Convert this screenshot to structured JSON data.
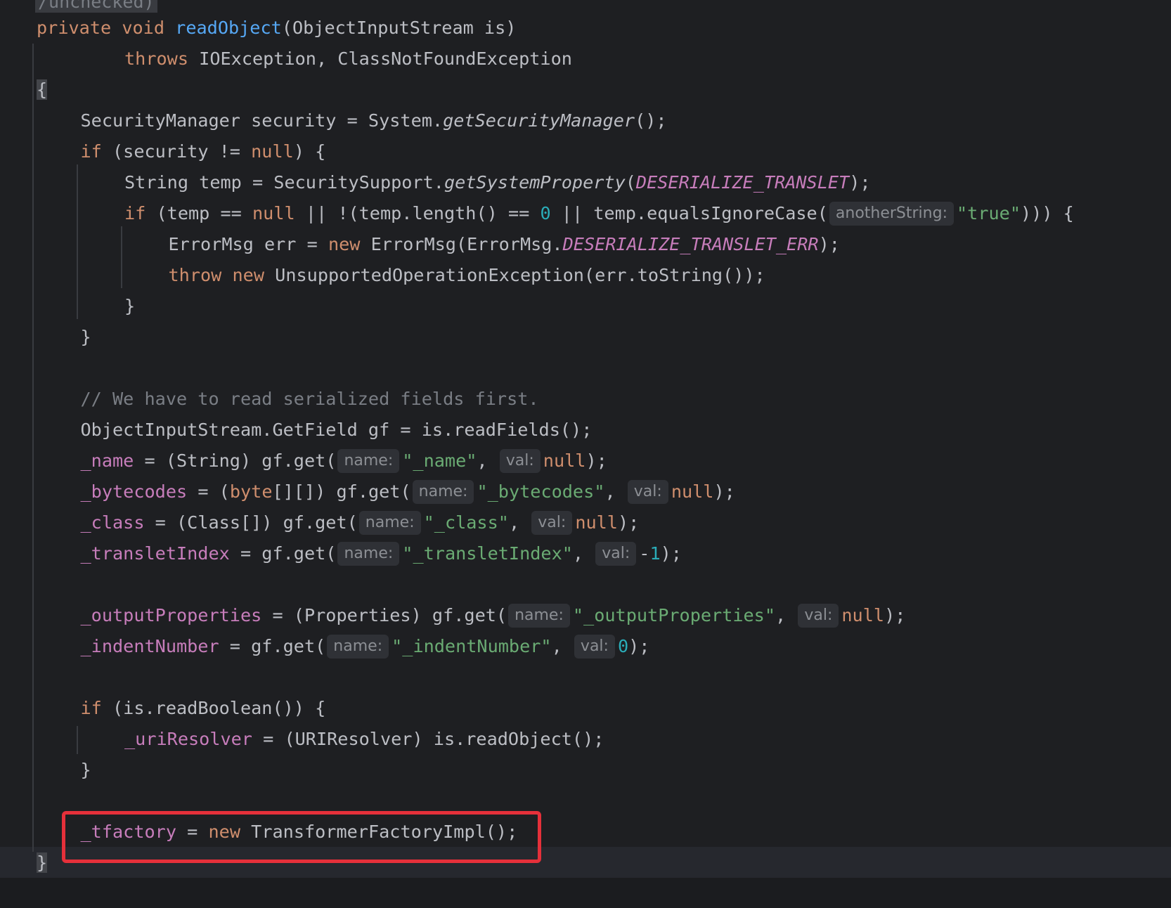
{
  "editor": {
    "partial_top_line": "/unchecked)",
    "lines": [
      {
        "indent": 0,
        "tokens": [
          [
            "kw",
            "private "
          ],
          [
            "kw",
            "void "
          ],
          [
            "fn",
            "readObject"
          ],
          [
            "plain",
            "(ObjectInputStream is)"
          ]
        ]
      },
      {
        "indent": 2,
        "tokens": [
          [
            "kw",
            "throws "
          ],
          [
            "plain",
            "IOException, ClassNotFoundException"
          ]
        ]
      },
      {
        "indent": 0,
        "tokens": [
          [
            "brace",
            "{"
          ]
        ]
      },
      {
        "indent": 1,
        "tokens": [
          [
            "plain",
            "SecurityManager security = System."
          ],
          [
            "static",
            "getSecurityManager"
          ],
          [
            "plain",
            "();"
          ]
        ]
      },
      {
        "indent": 1,
        "tokens": [
          [
            "kw",
            "if "
          ],
          [
            "plain",
            "(security != "
          ],
          [
            "kw",
            "null"
          ],
          [
            "plain",
            ") {"
          ]
        ]
      },
      {
        "indent": 2,
        "tokens": [
          [
            "plain",
            "String temp = SecuritySupport."
          ],
          [
            "static",
            "getSystemProperty"
          ],
          [
            "plain",
            "("
          ],
          [
            "const",
            "DESERIALIZE_TRANSLET"
          ],
          [
            "plain",
            ");"
          ]
        ]
      },
      {
        "indent": 2,
        "tokens": [
          [
            "kw",
            "if "
          ],
          [
            "plain",
            "(temp == "
          ],
          [
            "kw",
            "null"
          ],
          [
            "plain",
            " || !(temp.length() == "
          ],
          [
            "num",
            "0"
          ],
          [
            "plain",
            " || temp.equalsIgnoreCase("
          ],
          [
            "hint",
            "anotherString:"
          ],
          [
            "str",
            "\"true\""
          ],
          [
            "plain",
            "))) {"
          ]
        ]
      },
      {
        "indent": 3,
        "tokens": [
          [
            "plain",
            "ErrorMsg err = "
          ],
          [
            "kw",
            "new "
          ],
          [
            "plain",
            "ErrorMsg(ErrorMsg."
          ],
          [
            "const",
            "DESERIALIZE_TRANSLET_ERR"
          ],
          [
            "plain",
            ");"
          ]
        ]
      },
      {
        "indent": 3,
        "tokens": [
          [
            "kw",
            "throw "
          ],
          [
            "kw",
            "new "
          ],
          [
            "plain",
            "UnsupportedOperationException(err.toString());"
          ]
        ]
      },
      {
        "indent": 2,
        "tokens": [
          [
            "plain",
            "}"
          ]
        ]
      },
      {
        "indent": 1,
        "tokens": [
          [
            "plain",
            "}"
          ]
        ]
      },
      {
        "indent": 0,
        "tokens": []
      },
      {
        "indent": 1,
        "tokens": [
          [
            "cmt",
            "// We have to read serialized fields first."
          ]
        ]
      },
      {
        "indent": 1,
        "tokens": [
          [
            "plain",
            "ObjectInputStream.GetField gf = is.readFields();"
          ]
        ]
      },
      {
        "indent": 1,
        "tokens": [
          [
            "fld",
            "_name"
          ],
          [
            "plain",
            " = (String) gf.get("
          ],
          [
            "hint",
            "name:"
          ],
          [
            "str",
            "\"_name\""
          ],
          [
            "plain",
            ", "
          ],
          [
            "hint",
            "val:"
          ],
          [
            "kw",
            "null"
          ],
          [
            "plain",
            ");"
          ]
        ]
      },
      {
        "indent": 1,
        "tokens": [
          [
            "fld",
            "_bytecodes"
          ],
          [
            "plain",
            " = ("
          ],
          [
            "kw",
            "byte"
          ],
          [
            "plain",
            "[][]) gf.get("
          ],
          [
            "hint",
            "name:"
          ],
          [
            "str",
            "\"_bytecodes\""
          ],
          [
            "plain",
            ", "
          ],
          [
            "hint",
            "val:"
          ],
          [
            "kw",
            "null"
          ],
          [
            "plain",
            ");"
          ]
        ]
      },
      {
        "indent": 1,
        "tokens": [
          [
            "fld",
            "_class"
          ],
          [
            "plain",
            " = (Class[]) gf.get("
          ],
          [
            "hint",
            "name:"
          ],
          [
            "str",
            "\"_class\""
          ],
          [
            "plain",
            ", "
          ],
          [
            "hint",
            "val:"
          ],
          [
            "kw",
            "null"
          ],
          [
            "plain",
            ");"
          ]
        ]
      },
      {
        "indent": 1,
        "tokens": [
          [
            "fld",
            "_transletIndex"
          ],
          [
            "plain",
            " = gf.get("
          ],
          [
            "hint",
            "name:"
          ],
          [
            "str",
            "\"_transletIndex\""
          ],
          [
            "plain",
            ", "
          ],
          [
            "hint",
            "val:"
          ],
          [
            "plain",
            "-"
          ],
          [
            "num",
            "1"
          ],
          [
            "plain",
            ");"
          ]
        ]
      },
      {
        "indent": 0,
        "tokens": []
      },
      {
        "indent": 1,
        "tokens": [
          [
            "fld",
            "_outputProperties"
          ],
          [
            "plain",
            " = (Properties) gf.get("
          ],
          [
            "hint",
            "name:"
          ],
          [
            "str",
            "\"_outputProperties\""
          ],
          [
            "plain",
            ", "
          ],
          [
            "hint",
            "val:"
          ],
          [
            "kw",
            "null"
          ],
          [
            "plain",
            ");"
          ]
        ]
      },
      {
        "indent": 1,
        "tokens": [
          [
            "fld",
            "_indentNumber"
          ],
          [
            "plain",
            " = gf.get("
          ],
          [
            "hint",
            "name:"
          ],
          [
            "str",
            "\"_indentNumber\""
          ],
          [
            "plain",
            ", "
          ],
          [
            "hint",
            "val:"
          ],
          [
            "num",
            "0"
          ],
          [
            "plain",
            ");"
          ]
        ]
      },
      {
        "indent": 0,
        "tokens": []
      },
      {
        "indent": 1,
        "tokens": [
          [
            "kw",
            "if "
          ],
          [
            "plain",
            "(is.readBoolean()) {"
          ]
        ]
      },
      {
        "indent": 2,
        "tokens": [
          [
            "fld",
            "_uriResolver"
          ],
          [
            "plain",
            " = (URIResolver) is.readObject();"
          ]
        ]
      },
      {
        "indent": 1,
        "tokens": [
          [
            "plain",
            "}"
          ]
        ]
      },
      {
        "indent": 0,
        "tokens": []
      },
      {
        "indent": 1,
        "tokens": [
          [
            "fld",
            "_tfactory"
          ],
          [
            "plain",
            " = "
          ],
          [
            "kw",
            "new "
          ],
          [
            "plain",
            "TransformerFactoryImpl();"
          ]
        ]
      },
      {
        "indent": 0,
        "tokens": [
          [
            "brace",
            "}"
          ]
        ]
      }
    ]
  },
  "colors": {
    "background": "#1e1f22",
    "keyword": "#cf8e6d",
    "function": "#56a8f5",
    "field": "#c77dbb",
    "string": "#6aab73",
    "number": "#2aacb8",
    "comment": "#7a7e85",
    "highlight_box": "#e5303a"
  }
}
